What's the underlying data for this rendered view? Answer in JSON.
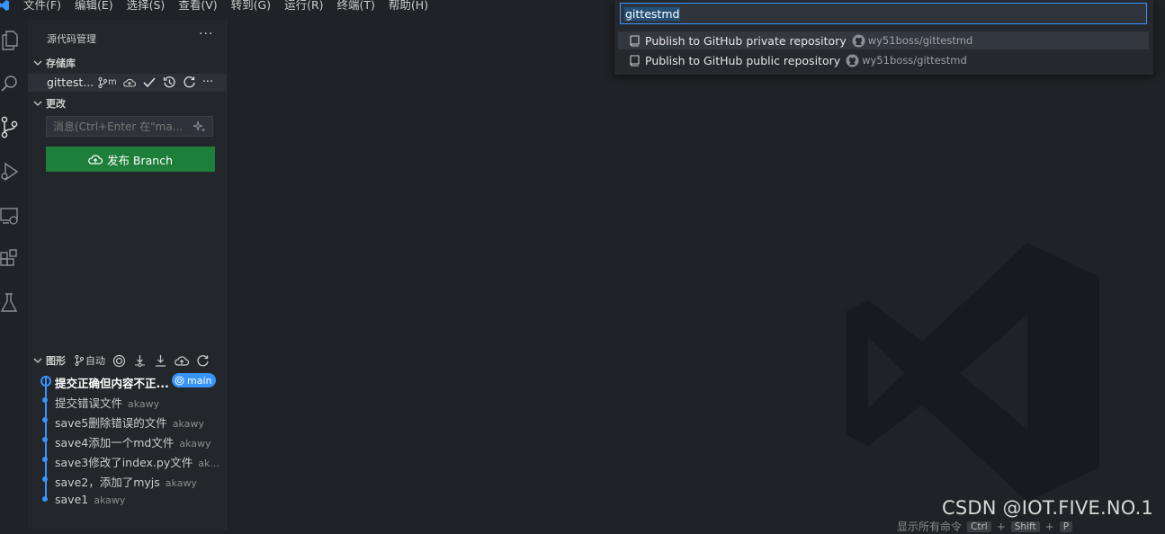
{
  "menubar": {
    "items": [
      "文件(F)",
      "编辑(E)",
      "选择(S)",
      "查看(V)",
      "转到(G)",
      "运行(R)",
      "终端(T)",
      "帮助(H)"
    ]
  },
  "activity_bar": {
    "icons": [
      "explorer-icon",
      "search-icon",
      "source-control-icon",
      "run-debug-icon",
      "remote-explorer-icon",
      "extensions-icon",
      "testing-icon"
    ]
  },
  "sidebar": {
    "title": "源代码管理",
    "more": "···",
    "repositories_label": "存储库",
    "repo": {
      "name": "gittest...",
      "branch_short": "m"
    },
    "changes_label": "更改",
    "message_placeholder": "消息(Ctrl+Enter 在\"ma...",
    "publish_label": "发布 Branch",
    "graph": {
      "label": "图形",
      "auto_label": "自动",
      "commits": [
        {
          "message": "提交正确但内容不正...",
          "author": "",
          "badge": "main",
          "head": true
        },
        {
          "message": "提交错误文件",
          "author": "akawy",
          "head": false
        },
        {
          "message": "save5删除错误的文件",
          "author": "akawy",
          "head": false
        },
        {
          "message": "save4添加一个md文件",
          "author": "akawy",
          "head": false
        },
        {
          "message": "save3修改了index.py文件",
          "author": "ak...",
          "head": false
        },
        {
          "message": "save2，添加了myjs",
          "author": "akawy",
          "head": false
        },
        {
          "message": "save1",
          "author": "akawy",
          "head": false
        }
      ]
    }
  },
  "quick_pick": {
    "input_value": "gittestmd",
    "items": [
      {
        "label": "Publish to GitHub private repository",
        "description": "wy51boss/gittestmd",
        "selected": true
      },
      {
        "label": "Publish to GitHub public repository",
        "description": "wy51boss/gittestmd",
        "selected": false
      }
    ]
  },
  "editor": {
    "hint_text": "显示所有命令",
    "hint_keys": [
      "Ctrl",
      "+",
      "Shift",
      "+",
      "P"
    ]
  },
  "watermark_text": "CSDN @IOT.FIVE.NO.1",
  "colors": {
    "accent": "#3794ff",
    "publish_button": "#1e7f3a",
    "background": "#1f2226",
    "sidebar": "#23262b"
  }
}
